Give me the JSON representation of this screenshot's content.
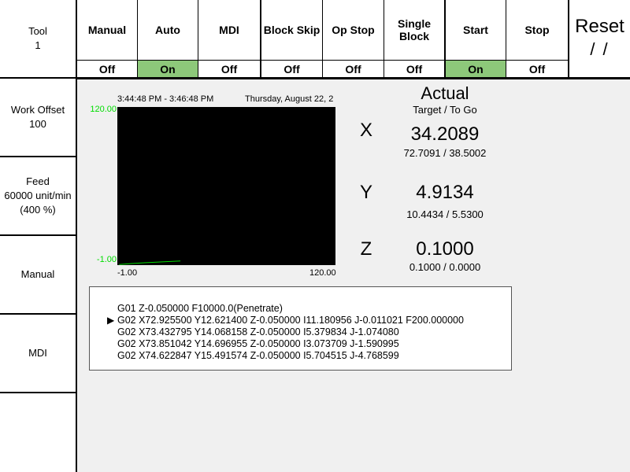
{
  "sidebar": {
    "tool": {
      "label": "Tool",
      "value": "1"
    },
    "work_offset": {
      "label": "Work Offset",
      "value": "100"
    },
    "feed": {
      "label": "Feed",
      "rate": "60000 unit/min",
      "percent": "(400 %)"
    },
    "manual": {
      "label": "Manual"
    },
    "mdi": {
      "label": "MDI"
    }
  },
  "topbar": {
    "manual": {
      "label": "Manual",
      "state": "Off"
    },
    "auto": {
      "label": "Auto",
      "state": "On"
    },
    "mdi": {
      "label": "MDI",
      "state": "Off"
    },
    "block_skip": {
      "label": "Block Skip",
      "state": "Off"
    },
    "op_stop": {
      "label": "Op Stop",
      "state": "Off"
    },
    "single_block_l1": "Single",
    "single_block_l2": "Block",
    "single_block_state": "Off",
    "start": {
      "label": "Start",
      "state": "On"
    },
    "stop": {
      "label": "Stop",
      "state": "Off"
    },
    "reset": {
      "label": "Reset",
      "status": "/ /"
    }
  },
  "colors": {
    "on_state": "#8dc87a",
    "plot_bg": "#000000",
    "plot_line": "#00dd00"
  },
  "plot": {
    "time_range": "3:44:48 PM - 3:46:48 PM",
    "date": "Thursday, August 22, 2",
    "y_max_label": "120.00",
    "y_min_label": "-1.00",
    "x_min_label": "-1.00",
    "x_max_label": "120.00"
  },
  "chart_data": {
    "type": "line",
    "xlim": [
      -1,
      120
    ],
    "ylim": [
      -1,
      120
    ],
    "series": [
      {
        "x": [
          0,
          7,
          14,
          25,
          34
        ],
        "y": [
          -0.5,
          0.2,
          0.8,
          1.5,
          2.2
        ]
      }
    ]
  },
  "readout": {
    "title": "Actual",
    "subtitle": "Target / To Go",
    "axes": [
      {
        "letter": "X",
        "actual": "34.2089",
        "target_togo": "72.7091 / 38.5002"
      },
      {
        "letter": "Y",
        "actual": "4.9134",
        "target_togo": "10.4434 / 5.5300"
      },
      {
        "letter": "Z",
        "actual": "0.1000",
        "target_togo": "0.1000 / 0.0000"
      }
    ]
  },
  "gcode": {
    "pointer": "▶",
    "lines": [
      "G01 Z-0.050000 F10000.0(Penetrate)",
      "G02 X72.925500 Y12.621400 Z-0.050000 I11.180956 J-0.011021 F200.000000",
      "G02 X73.432795 Y14.068158 Z-0.050000 I5.379834 J-1.074080",
      "G02 X73.851042 Y14.696955 Z-0.050000 I3.073709 J-1.590995",
      "G02 X74.622847 Y15.491574 Z-0.050000 I5.704515 J-4.768599"
    ]
  }
}
